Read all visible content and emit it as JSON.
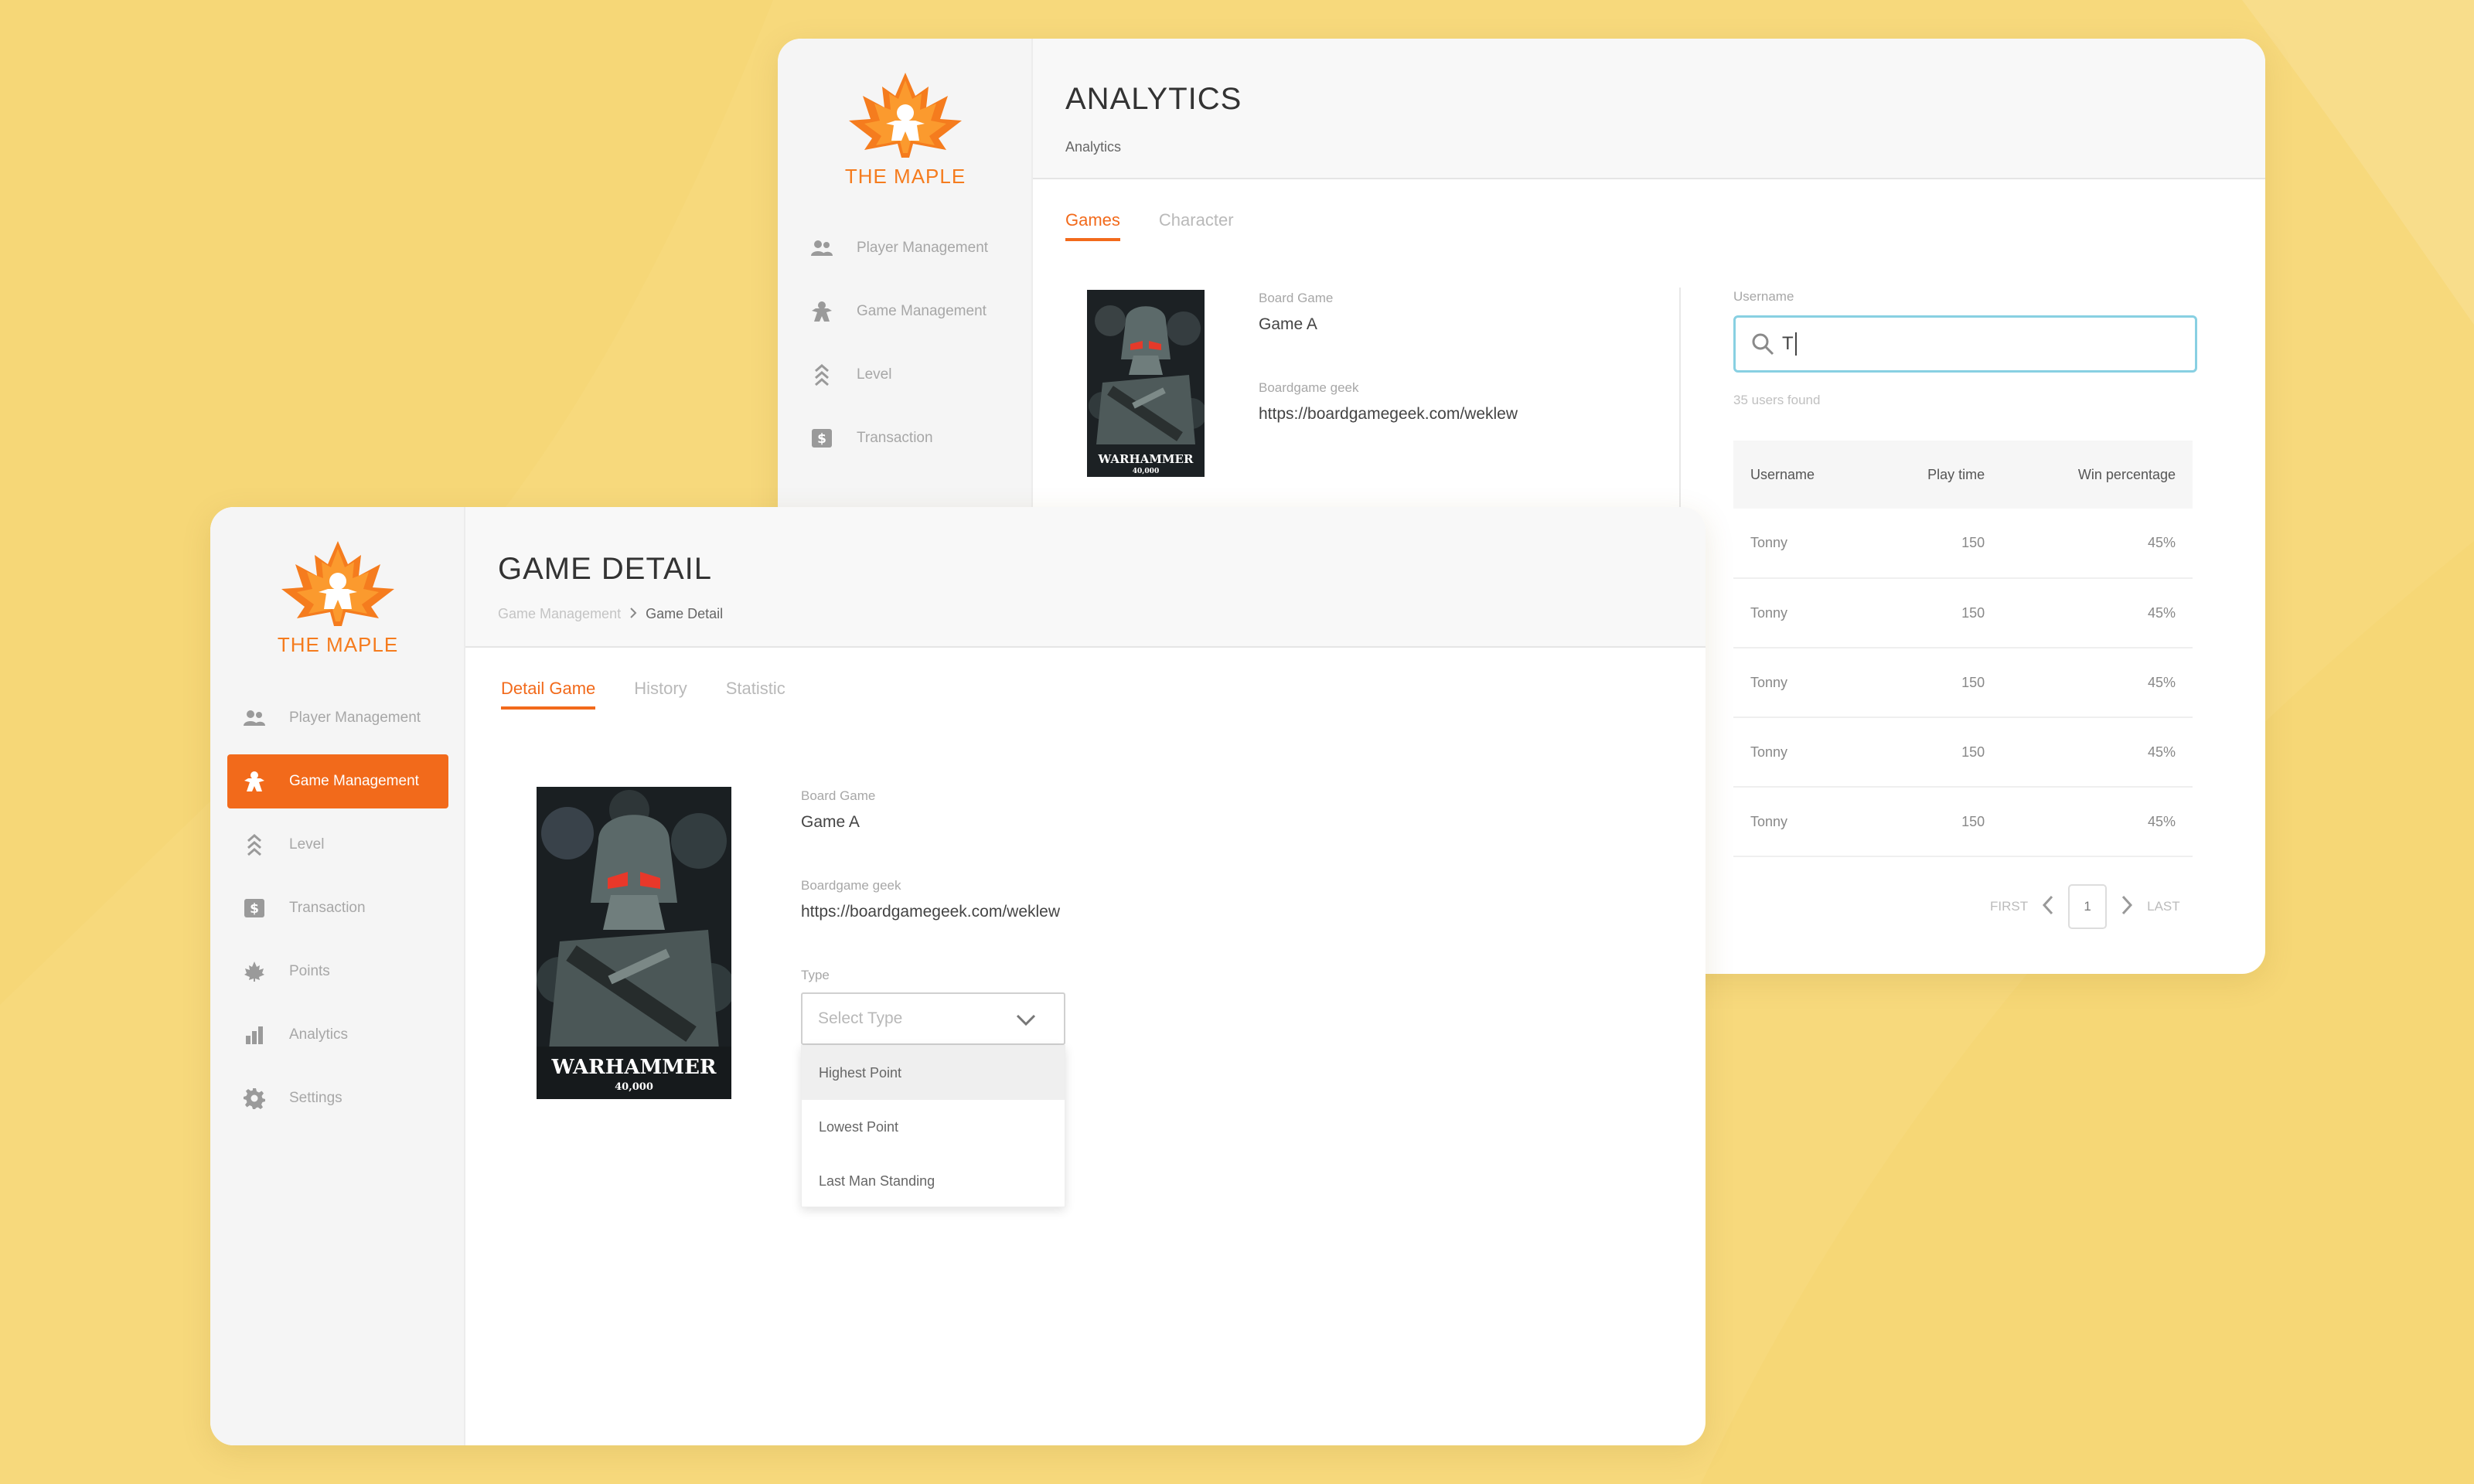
{
  "colors": {
    "background": "#f7d97c",
    "accent": "#f26a1b",
    "focus": "#88d0e2"
  },
  "brand": {
    "name": "THE MAPLE"
  },
  "analytics_window": {
    "title": "ANALYTICS",
    "breadcrumb": "Analytics",
    "nav": [
      {
        "label": "Player Management",
        "icon": "users-icon"
      },
      {
        "label": "Game Management",
        "icon": "meeple-icon"
      },
      {
        "label": "Level",
        "icon": "chevrons-up-icon"
      },
      {
        "label": "Transaction",
        "icon": "dollar-icon"
      }
    ],
    "tabs": [
      "Games",
      "Character"
    ],
    "active_tab": "Games",
    "game": {
      "board_game_label": "Board Game",
      "board_game_value": "Game A",
      "geek_label": "Boardgame geek",
      "geek_value": "https://boardgamegeek.com/weklew",
      "poster_title": "WARHAMMER",
      "poster_subtitle": "40,000"
    },
    "search": {
      "label": "Username",
      "value": "T",
      "found": "35 users found"
    },
    "table": {
      "columns": [
        "Username",
        "Play time",
        "Win percentage"
      ],
      "rows": [
        [
          "Tonny",
          "150",
          "45%"
        ],
        [
          "Tonny",
          "150",
          "45%"
        ],
        [
          "Tonny",
          "150",
          "45%"
        ],
        [
          "Tonny",
          "150",
          "45%"
        ],
        [
          "Tonny",
          "150",
          "45%"
        ]
      ]
    },
    "pager": {
      "first": "FIRST",
      "page": "1",
      "last": "LAST"
    }
  },
  "detail_window": {
    "title": "GAME DETAIL",
    "breadcrumb": {
      "parent": "Game Management",
      "current": "Game Detail"
    },
    "nav": [
      {
        "label": "Player Management",
        "icon": "users-icon"
      },
      {
        "label": "Game Management",
        "icon": "meeple-icon",
        "active": true
      },
      {
        "label": "Level",
        "icon": "chevrons-up-icon"
      },
      {
        "label": "Transaction",
        "icon": "dollar-icon"
      },
      {
        "label": "Points",
        "icon": "maple-leaf-icon"
      },
      {
        "label": "Analytics",
        "icon": "bar-chart-icon"
      },
      {
        "label": "Settings",
        "icon": "gear-icon"
      }
    ],
    "tabs": [
      "Detail Game",
      "History",
      "Statistic"
    ],
    "active_tab": "Detail Game",
    "game": {
      "board_game_label": "Board Game",
      "board_game_value": "Game A",
      "geek_label": "Boardgame geek",
      "geek_value": "https://boardgamegeek.com/weklew",
      "type_label": "Type",
      "type_placeholder": "Select Type",
      "type_options": [
        "Highest Point",
        "Lowest Point",
        "Last Man Standing"
      ],
      "highlighted_option": "Highest Point",
      "poster_title": "WARHAMMER",
      "poster_subtitle": "40,000"
    }
  }
}
